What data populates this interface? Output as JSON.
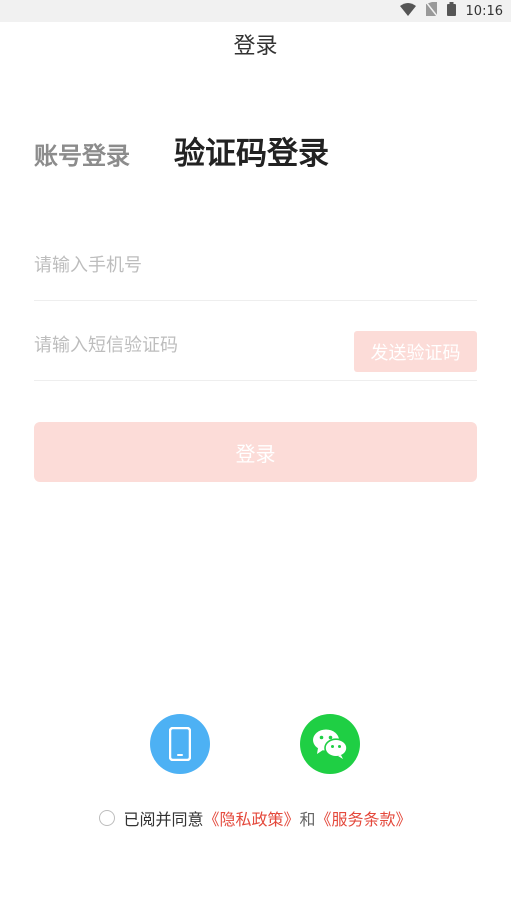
{
  "status_bar": {
    "time": "10:16"
  },
  "header": {
    "title": "登录"
  },
  "tabs": {
    "account_login": "账号登录",
    "code_login": "验证码登录"
  },
  "form": {
    "phone_placeholder": "请输入手机号",
    "code_placeholder": "请输入短信验证码",
    "send_code_label": "发送验证码",
    "login_label": "登录"
  },
  "alt_login": {
    "phone_icon": "smartphone-icon",
    "wechat_icon": "wechat-icon"
  },
  "agreement": {
    "prefix": "已阅并同意",
    "privacy_link": "《隐私政策》",
    "and": "和",
    "terms_link": "《服务条款》"
  },
  "colors": {
    "accent_disabled": "#fcdcd8",
    "link": "#e4493c",
    "phone_blue": "#4db1f4",
    "wechat_green": "#1fcf44"
  }
}
